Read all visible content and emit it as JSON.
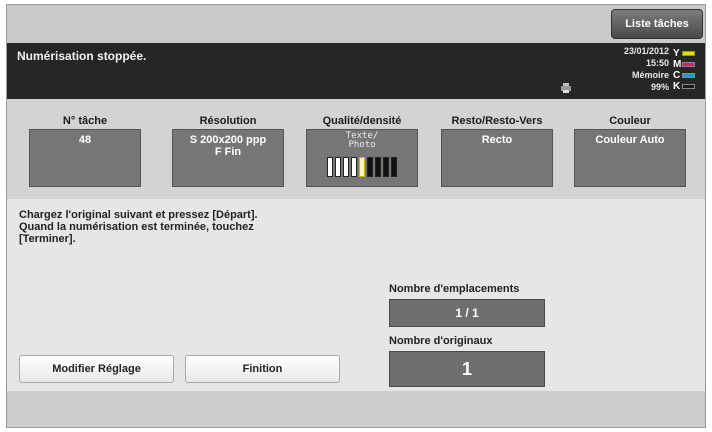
{
  "header": {
    "job_list_label": "Liste tâches"
  },
  "status": {
    "message": "Numérisation stoppée.",
    "date": "23/01/2012",
    "time": "15:50",
    "memory_label": "Mémoire",
    "memory_value": "99%",
    "toner": [
      {
        "label": "Y",
        "color": "#e8e000"
      },
      {
        "label": "M",
        "color": "#d0207a"
      },
      {
        "label": "C",
        "color": "#1a9ad6"
      },
      {
        "label": "K",
        "color": "#1a1a1a"
      }
    ]
  },
  "settings": {
    "job_no": {
      "label": "N° tâche",
      "value": "48"
    },
    "resolution": {
      "label": "Résolution",
      "value_line1": "S 200x200 ppp",
      "value_line2": "F Fin"
    },
    "quality": {
      "label": "Qualité/densité",
      "text_line1": "Texte/",
      "text_line2": "Photo",
      "density_level": 5,
      "density_steps": 9
    },
    "duplex": {
      "label": "Resto/Resto-Vers",
      "value": "Recto"
    },
    "color": {
      "label": "Couleur",
      "value": "Couleur Auto"
    }
  },
  "main": {
    "instruction": "Chargez l'original suivant et pressez [Départ].\nQuand la numérisation est terminée, touchez\n[Terminer].",
    "modify_button": "Modifier Réglage",
    "finish_button": "Finition",
    "slots_label": "Nombre d'emplacements",
    "slots_value": "1 / 1",
    "originals_label": "Nombre d'originaux",
    "originals_value": "1"
  }
}
